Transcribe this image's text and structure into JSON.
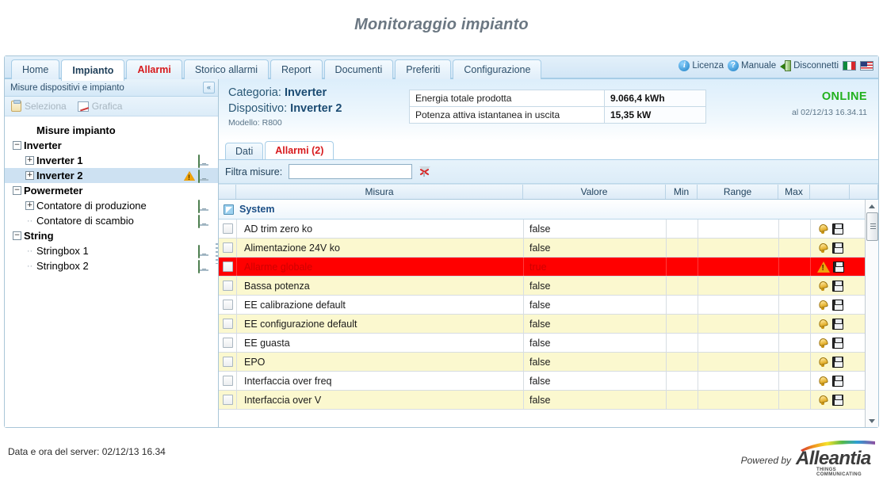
{
  "page": {
    "title": "Monitoraggio impianto"
  },
  "menu": {
    "tabs": [
      {
        "label": "Home",
        "state": "normal"
      },
      {
        "label": "Impianto",
        "state": "active"
      },
      {
        "label": "Allarmi",
        "state": "alarm"
      },
      {
        "label": "Storico allarmi",
        "state": "normal"
      },
      {
        "label": "Report",
        "state": "normal"
      },
      {
        "label": "Documenti",
        "state": "normal"
      },
      {
        "label": "Preferiti",
        "state": "normal"
      },
      {
        "label": "Configurazione",
        "state": "normal"
      }
    ],
    "right": {
      "licenza": "Licenza",
      "licenza_icon": "info-circle-icon",
      "manuale": "Manuale",
      "manuale_icon": "question-circle-icon",
      "disconnetti": "Disconnetti",
      "disconnetti_icon": "logout-door-icon",
      "flag_it": "it-flag-icon",
      "flag_us": "us-flag-icon"
    }
  },
  "sidebar": {
    "header_title": "Misure dispositivi e impianto",
    "collapse_glyph": "«",
    "toolbar": {
      "seleziona": "Seleziona",
      "grafica": "Grafica"
    },
    "tree": [
      {
        "label": "Misure impianto",
        "level": 0,
        "marker": "none",
        "bold": true,
        "status": "none",
        "selected": false
      },
      {
        "label": "Inverter",
        "level": 0,
        "marker": "minus",
        "bold": true,
        "status": "none",
        "selected": false
      },
      {
        "label": "Inverter 1",
        "level": 1,
        "marker": "plus",
        "bold": true,
        "status": "device",
        "selected": false
      },
      {
        "label": "Inverter 2",
        "level": 1,
        "marker": "plus",
        "bold": true,
        "status": "warn",
        "selected": true
      },
      {
        "label": "Powermeter",
        "level": 0,
        "marker": "minus",
        "bold": true,
        "status": "none",
        "selected": false
      },
      {
        "label": "Contatore di produzione",
        "level": 1,
        "marker": "plus",
        "bold": false,
        "status": "device",
        "selected": false
      },
      {
        "label": "Contatore di scambio",
        "level": 1,
        "marker": "dash",
        "bold": false,
        "status": "device",
        "selected": false
      },
      {
        "label": "String",
        "level": 0,
        "marker": "minus",
        "bold": true,
        "status": "none",
        "selected": false
      },
      {
        "label": "Stringbox 1",
        "level": 1,
        "marker": "dash",
        "bold": false,
        "status": "device",
        "selected": false
      },
      {
        "label": "Stringbox 2",
        "level": 1,
        "marker": "dash",
        "bold": false,
        "status": "device",
        "selected": false
      }
    ]
  },
  "detail": {
    "categoria_label": "Categoria:",
    "categoria_value": "Inverter",
    "dispositivo_label": "Dispositivo:",
    "dispositivo_value": "Inverter 2",
    "modello": "Modello: R800",
    "summary": [
      {
        "label": "Energia totale prodotta",
        "value": "9.066,4 kWh"
      },
      {
        "label": "Potenza attiva istantanea in uscita",
        "value": "15,35 kW"
      }
    ],
    "status": "ONLINE",
    "status_color": "#22b11e",
    "status_timestamp": "al 02/12/13 16.34.11"
  },
  "inner_tabs": [
    {
      "label": "Dati",
      "active": false
    },
    {
      "label": "Allarmi (2)",
      "active": true
    }
  ],
  "filter": {
    "label": "Filtra misure:",
    "value": "",
    "placeholder": "",
    "clear_icon": "clear-filter-funnel-icon"
  },
  "grid": {
    "columns": [
      "",
      "Misura",
      "Valore",
      "Min",
      "Range",
      "Max",
      ""
    ],
    "group": {
      "label": "System",
      "checkbox": "partial"
    },
    "rows": [
      {
        "misura": "AD trim zero ko",
        "valore": "false",
        "min": "",
        "range": "",
        "max": "",
        "state": "normal",
        "icon": "bell-icon"
      },
      {
        "misura": "Alimentazione 24V ko",
        "valore": "false",
        "min": "",
        "range": "",
        "max": "",
        "state": "normal",
        "icon": "bell-icon"
      },
      {
        "misura": "Allarme globale",
        "valore": "true",
        "min": "",
        "range": "",
        "max": "",
        "state": "alarm",
        "icon": "warning-triangle-icon"
      },
      {
        "misura": "Bassa potenza",
        "valore": "false",
        "min": "",
        "range": "",
        "max": "",
        "state": "normal",
        "icon": "bell-icon"
      },
      {
        "misura": "EE calibrazione default",
        "valore": "false",
        "min": "",
        "range": "",
        "max": "",
        "state": "normal",
        "icon": "bell-icon"
      },
      {
        "misura": "EE configurazione default",
        "valore": "false",
        "min": "",
        "range": "",
        "max": "",
        "state": "normal",
        "icon": "bell-icon"
      },
      {
        "misura": "EE guasta",
        "valore": "false",
        "min": "",
        "range": "",
        "max": "",
        "state": "normal",
        "icon": "bell-icon"
      },
      {
        "misura": "EPO",
        "valore": "false",
        "min": "",
        "range": "",
        "max": "",
        "state": "normal",
        "icon": "bell-icon"
      },
      {
        "misura": "Interfaccia over freq",
        "valore": "false",
        "min": "",
        "range": "",
        "max": "",
        "state": "normal",
        "icon": "bell-icon"
      },
      {
        "misura": "Interfaccia over V",
        "valore": "false",
        "min": "",
        "range": "",
        "max": "",
        "state": "normal",
        "icon": "bell-icon"
      }
    ]
  },
  "footer": {
    "server_time": "Data e ora del server: 02/12/13 16.34",
    "powered_by": "Powered by",
    "brand": "Alleantia",
    "tagline": "THINGS COMMUNICATING"
  }
}
